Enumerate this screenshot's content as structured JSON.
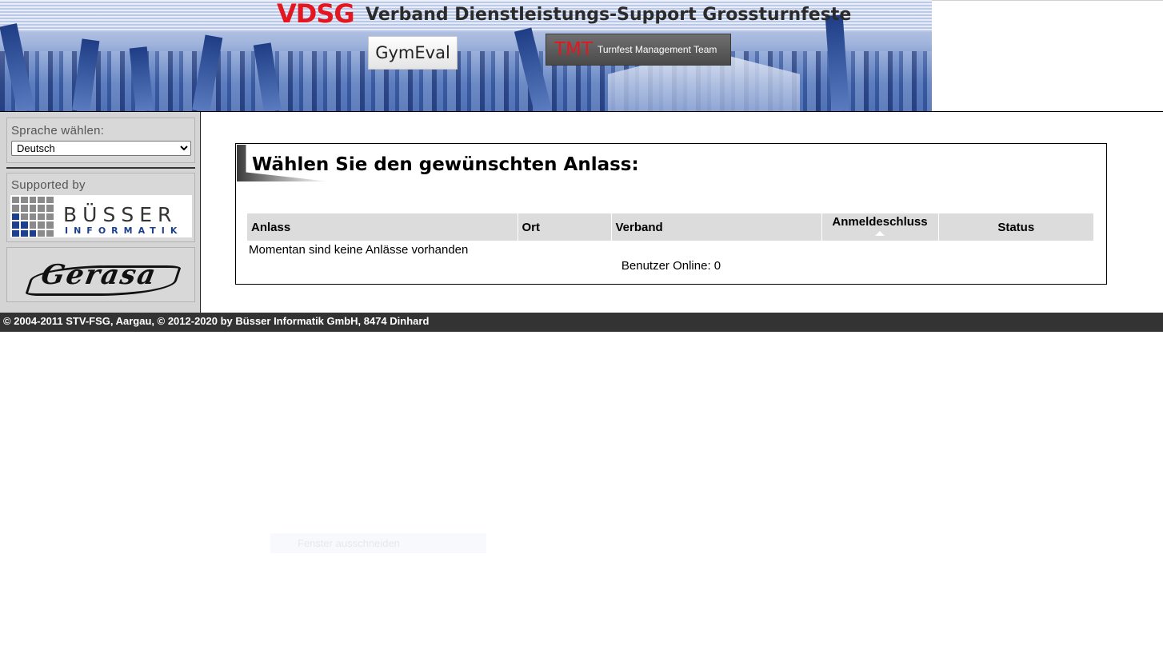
{
  "banner": {
    "vdsg_logo": "VDSG",
    "title": "Verband Dienstleistungs-Support Grossturnfeste",
    "gymeval_label": "GymEval",
    "tmt_mark": "TMT",
    "tmt_text": "Turnfest Management Team"
  },
  "sidebar": {
    "language_label": "Sprache wählen:",
    "language_options": [
      "Deutsch"
    ],
    "language_selected": "Deutsch",
    "supported_label": "Supported by",
    "busser_name": "BÜSSER",
    "busser_sub": "INFORMATIK",
    "gerasa_name": "Gerasa"
  },
  "main": {
    "title": "Wählen Sie den gewünschten Anlass:",
    "table": {
      "columns": [
        "Anlass",
        "Ort",
        "Verband",
        "Anmeldeschluss",
        "Status"
      ],
      "rows": []
    },
    "empty_message": "Momentan sind keine Anlässe vorhanden",
    "users_online": "Benutzer Online: 0"
  },
  "footer": {
    "text": "© 2004-2011 STV-FSG, Aargau, © 2012-2020 by Büsser Informatik GmbH, 8474 Dinhard"
  },
  "overlay": {
    "tooltip_text": "Fenster ausschneiden"
  },
  "colors": {
    "vdsg_red": "#e4161f",
    "banner_blue": "#3b5da6",
    "sidebar_bg": "#d4d4d4",
    "table_header_bg": "#dcdcdc",
    "footer_bg": "#333333",
    "busser_blue": "#1d3f8f"
  }
}
